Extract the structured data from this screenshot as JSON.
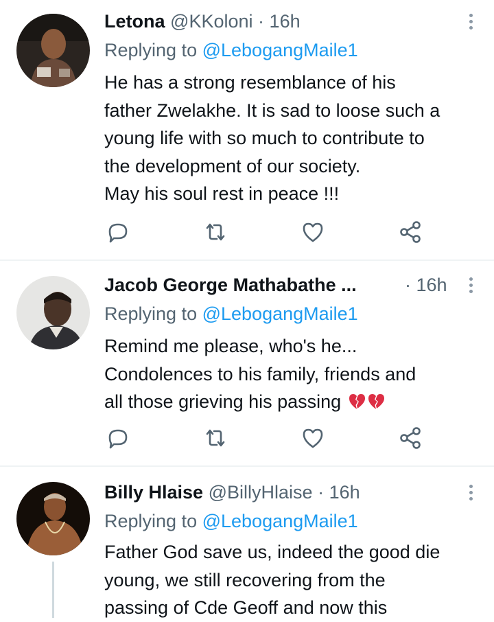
{
  "tweets": [
    {
      "name": "Letona",
      "handle": "@KKoloni",
      "separator": "·",
      "time": "16h",
      "replying_prefix": "Replying to ",
      "replying_to": "@LebogangMaile1",
      "lines": [
        "He has a strong resemblance of his",
        "father Zwelakhe. It is sad to loose such a",
        "young life with so much to contribute to",
        "the development of our society.",
        "May his soul rest in peace !!!"
      ]
    },
    {
      "name": "Jacob George Mathabathe ...",
      "handle": "",
      "separator": "·",
      "time": "16h",
      "replying_prefix": "Replying to ",
      "replying_to": "@LebogangMaile1",
      "lines": [
        "Remind me please, who's he...",
        "Condolences to his family, friends and",
        "all those grieving his passing"
      ],
      "emoji": [
        "broken-heart-icon",
        "broken-heart-icon"
      ]
    },
    {
      "name": "Billy Hlaise",
      "handle": "@BillyHlaise",
      "separator": "·",
      "time": "16h",
      "replying_prefix": "Replying to ",
      "replying_to": "@LebogangMaile1",
      "lines": [
        "Father God save us, indeed the good die",
        "young,  we still recovering from the",
        "passing of Cde Geoff and now this"
      ]
    }
  ],
  "icons": [
    "reply-icon",
    "retweet-icon",
    "like-icon",
    "share-icon",
    "more-icon"
  ],
  "colors": {
    "text": "#0f1419",
    "secondary": "#536471",
    "link": "#1d9bf0",
    "divider": "#eff3f4",
    "icon": "#536471",
    "emoji": "#dd2e44"
  }
}
